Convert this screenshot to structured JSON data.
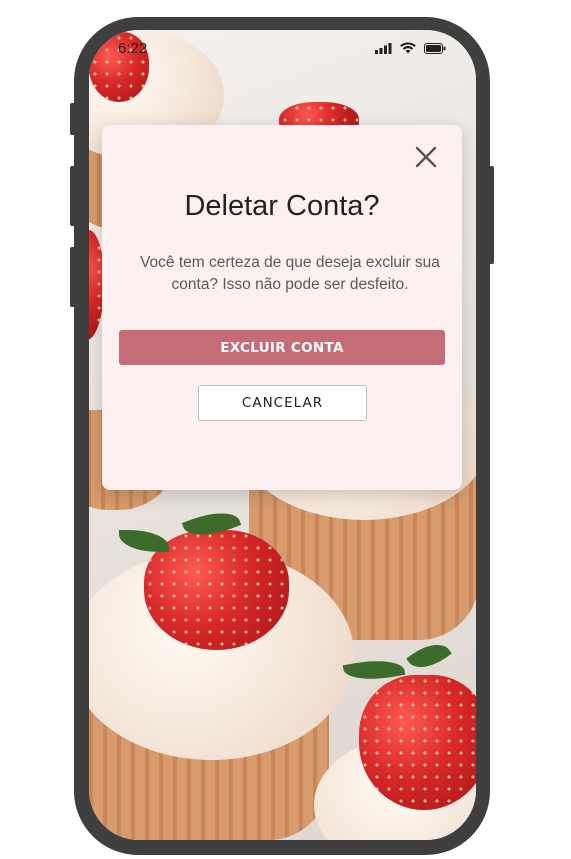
{
  "status_bar": {
    "time": "6:22",
    "icons": [
      "signal-icon",
      "wifi-icon",
      "battery-icon"
    ]
  },
  "background": {
    "description_icon": "cupcakes-photo",
    "colors": {
      "frosting": "#f7ebe0",
      "strawberry": "#d8282a",
      "cake": "#d79b6e"
    }
  },
  "modal": {
    "close_icon": "close-icon",
    "title": "Deletar Conta?",
    "message": "Você tem certeza de que deseja excluir sua conta? Isso não pode ser desfeito.",
    "delete_label": "EXCLUIR CONTA",
    "cancel_label": "CANCELAR",
    "colors": {
      "background": "#fdf0f1",
      "delete_button": "#c56d76",
      "cancel_button": "#ffffff"
    }
  },
  "device": {
    "frame_color": "#3f3f3f"
  }
}
